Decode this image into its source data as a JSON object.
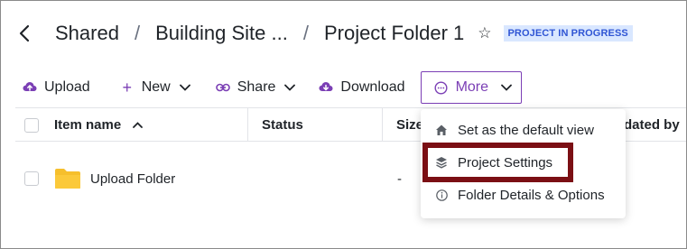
{
  "breadcrumb": {
    "items": [
      "Shared",
      "Building Site ...",
      "Project Folder 1"
    ],
    "separator": "/",
    "badge": "PROJECT IN PROGRESS"
  },
  "toolbar": {
    "upload": "Upload",
    "new": "New",
    "share": "Share",
    "download": "Download",
    "more": "More"
  },
  "table": {
    "columns": [
      "Item name",
      "Status",
      "Size",
      "Updated by"
    ],
    "rows": [
      {
        "name": "Upload Folder",
        "status": "",
        "size": "-"
      }
    ]
  },
  "menu": {
    "items": [
      "Set as the default view",
      "Project Settings",
      "Folder Details & Options"
    ]
  },
  "colors": {
    "accent_purple": "#7b3fb5",
    "badge_bg": "#d9e7ff",
    "badge_text": "#2f55d4",
    "highlight": "#7b0f14",
    "folder": "#f6bf2c"
  }
}
